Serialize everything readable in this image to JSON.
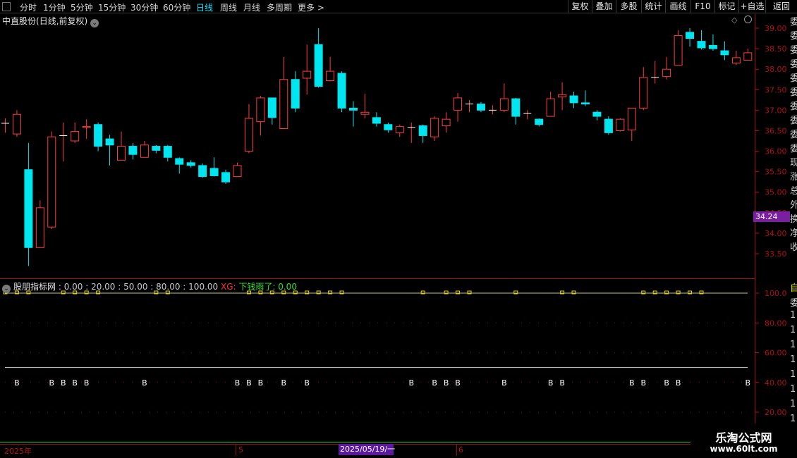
{
  "toolbar": {
    "periods": [
      "分时",
      "1分钟",
      "5分钟",
      "15分钟",
      "30分钟",
      "60分钟",
      "日线",
      "周线",
      "月线",
      "多周期",
      "更多 >"
    ],
    "active_period": "日线",
    "buttons": [
      "复权",
      "叠加",
      "多股",
      "统计",
      "画线",
      "F10",
      "标记",
      "+自选",
      "返回"
    ]
  },
  "stock": {
    "name": "中直股份",
    "mode": "(日线,前复权)"
  },
  "price_axis": {
    "labels": [
      "39.00",
      "38.50",
      "38.00",
      "37.50",
      "37.00",
      "36.50",
      "36.00",
      "35.50",
      "35.00",
      "34.50",
      "34.00",
      "33.50"
    ],
    "current_price": "34.24"
  },
  "indicator": {
    "name": "股朋指标网",
    "params": ": 0.00 : 20.00 : 50.00 : 80.00 : 100.00",
    "xg_label": "XG:",
    "xg_text": "下钱雨了: 0.00",
    "axis_labels": [
      "100.0",
      "80.00",
      "60.00",
      "40.00",
      "20.00"
    ],
    "marker_label": "B"
  },
  "dates": {
    "start": "2025年",
    "m5": "5",
    "m6": "6",
    "cursor": "2025/05/19/一"
  },
  "watermark": {
    "title": "乐淘公式网",
    "url": "www.60lt.com"
  },
  "right_strip": {
    "chars": [
      "委",
      "委",
      "委",
      "委",
      "委",
      "委",
      "委",
      "委",
      "委",
      "委",
      "现",
      "涨",
      "总",
      "外",
      "换",
      "净",
      "收"
    ],
    "chars2": [
      "自",
      "委",
      "1",
      "1",
      "1",
      "1",
      "1",
      "1",
      "1",
      "1",
      "1"
    ]
  },
  "colors": {
    "up": "#ff3c3c",
    "down": "#00e6f0",
    "axis": "#b01010",
    "marker_yellow": "#e6d600",
    "current_price_bg": "#7b1fa2"
  },
  "chart_data": {
    "type": "candlestick",
    "y_axis": {
      "min": 33.5,
      "max": 39.0,
      "ticks": [
        33.5,
        34.0,
        34.5,
        35.0,
        35.5,
        36.0,
        36.5,
        37.0,
        37.5,
        38.0,
        38.5,
        39.0
      ]
    },
    "candles": [
      {
        "o": 36.68,
        "c": 36.68,
        "h": 36.8,
        "l": 36.45
      },
      {
        "o": 36.42,
        "c": 36.9,
        "h": 37.0,
        "l": 36.35
      },
      {
        "o": 35.55,
        "c": 33.65,
        "h": 36.2,
        "l": 33.2
      },
      {
        "o": 33.65,
        "c": 34.62,
        "h": 34.8,
        "l": 33.65
      },
      {
        "o": 34.15,
        "c": 36.35,
        "h": 36.48,
        "l": 34.1
      },
      {
        "o": 36.38,
        "c": 36.38,
        "h": 36.7,
        "l": 35.75
      },
      {
        "o": 36.25,
        "c": 36.48,
        "h": 36.7,
        "l": 36.2
      },
      {
        "o": 36.58,
        "c": 36.6,
        "h": 36.78,
        "l": 36.3
      },
      {
        "o": 36.65,
        "c": 36.12,
        "h": 36.7,
        "l": 36.0
      },
      {
        "o": 36.3,
        "c": 36.15,
        "h": 36.4,
        "l": 35.65
      },
      {
        "o": 35.78,
        "c": 36.12,
        "h": 36.48,
        "l": 35.78
      },
      {
        "o": 36.12,
        "c": 35.92,
        "h": 36.2,
        "l": 35.8
      },
      {
        "o": 35.85,
        "c": 36.15,
        "h": 36.25,
        "l": 35.85
      },
      {
        "o": 36.12,
        "c": 36.02,
        "h": 36.15,
        "l": 35.95
      },
      {
        "o": 36.12,
        "c": 35.85,
        "h": 36.15,
        "l": 35.75
      },
      {
        "o": 35.82,
        "c": 35.68,
        "h": 35.85,
        "l": 35.45
      },
      {
        "o": 35.72,
        "c": 35.65,
        "h": 35.78,
        "l": 35.6
      },
      {
        "o": 35.65,
        "c": 35.38,
        "h": 35.7,
        "l": 35.35
      },
      {
        "o": 35.58,
        "c": 35.4,
        "h": 35.85,
        "l": 35.38
      },
      {
        "o": 35.48,
        "c": 35.25,
        "h": 35.55,
        "l": 35.2
      },
      {
        "o": 35.38,
        "c": 35.65,
        "h": 35.72,
        "l": 35.38
      },
      {
        "o": 36.0,
        "c": 36.8,
        "h": 37.15,
        "l": 35.95
      },
      {
        "o": 36.72,
        "c": 37.3,
        "h": 37.35,
        "l": 36.38
      },
      {
        "o": 37.3,
        "c": 36.82,
        "h": 37.3,
        "l": 36.65
      },
      {
        "o": 36.55,
        "c": 37.75,
        "h": 38.3,
        "l": 36.55
      },
      {
        "o": 37.75,
        "c": 37.05,
        "h": 37.95,
        "l": 36.95
      },
      {
        "o": 37.78,
        "c": 37.95,
        "h": 38.6,
        "l": 37.38
      },
      {
        "o": 38.6,
        "c": 37.58,
        "h": 39.0,
        "l": 37.55
      },
      {
        "o": 37.72,
        "c": 37.95,
        "h": 38.3,
        "l": 37.7
      },
      {
        "o": 37.9,
        "c": 37.05,
        "h": 37.95,
        "l": 36.95
      },
      {
        "o": 37.05,
        "c": 37.0,
        "h": 37.22,
        "l": 36.6
      },
      {
        "o": 36.9,
        "c": 36.95,
        "h": 37.4,
        "l": 36.8
      },
      {
        "o": 36.82,
        "c": 36.68,
        "h": 36.95,
        "l": 36.6
      },
      {
        "o": 36.65,
        "c": 36.52,
        "h": 36.7,
        "l": 36.45
      },
      {
        "o": 36.45,
        "c": 36.6,
        "h": 36.65,
        "l": 36.35
      },
      {
        "o": 36.58,
        "c": 36.58,
        "h": 36.7,
        "l": 36.2
      },
      {
        "o": 36.62,
        "c": 36.38,
        "h": 36.65,
        "l": 36.2
      },
      {
        "o": 36.35,
        "c": 36.8,
        "h": 36.85,
        "l": 36.25
      },
      {
        "o": 36.62,
        "c": 36.78,
        "h": 36.95,
        "l": 36.45
      },
      {
        "o": 37.0,
        "c": 37.3,
        "h": 37.42,
        "l": 36.72
      },
      {
        "o": 37.15,
        "c": 37.15,
        "h": 37.25,
        "l": 36.95
      },
      {
        "o": 37.15,
        "c": 37.0,
        "h": 37.2,
        "l": 36.95
      },
      {
        "o": 37.0,
        "c": 37.0,
        "h": 37.12,
        "l": 36.9
      },
      {
        "o": 37.0,
        "c": 37.28,
        "h": 37.65,
        "l": 36.95
      },
      {
        "o": 37.28,
        "c": 36.85,
        "h": 37.3,
        "l": 36.65
      },
      {
        "o": 36.92,
        "c": 36.92,
        "h": 37.0,
        "l": 36.78
      },
      {
        "o": 36.78,
        "c": 36.65,
        "h": 36.8,
        "l": 36.6
      },
      {
        "o": 36.85,
        "c": 37.28,
        "h": 37.45,
        "l": 36.85
      },
      {
        "o": 37.32,
        "c": 37.38,
        "h": 37.68,
        "l": 37.0
      },
      {
        "o": 37.35,
        "c": 37.18,
        "h": 37.45,
        "l": 37.05
      },
      {
        "o": 37.18,
        "c": 37.15,
        "h": 37.48,
        "l": 37.1
      },
      {
        "o": 36.95,
        "c": 36.85,
        "h": 37.0,
        "l": 36.75
      },
      {
        "o": 36.78,
        "c": 36.45,
        "h": 36.85,
        "l": 36.4
      },
      {
        "o": 36.5,
        "c": 36.78,
        "h": 36.8,
        "l": 36.48
      },
      {
        "o": 36.52,
        "c": 37.05,
        "h": 37.05,
        "l": 36.25
      },
      {
        "o": 37.05,
        "c": 37.8,
        "h": 38.05,
        "l": 37.0
      },
      {
        "o": 37.8,
        "c": 37.8,
        "h": 38.2,
        "l": 37.65
      },
      {
        "o": 37.82,
        "c": 38.0,
        "h": 38.3,
        "l": 37.75
      },
      {
        "o": 38.1,
        "c": 38.82,
        "h": 38.95,
        "l": 38.1
      },
      {
        "o": 38.9,
        "c": 38.75,
        "h": 39.0,
        "l": 38.55
      },
      {
        "o": 38.68,
        "c": 38.52,
        "h": 38.95,
        "l": 38.48
      },
      {
        "o": 38.58,
        "c": 38.5,
        "h": 38.85,
        "l": 38.45
      },
      {
        "o": 38.45,
        "c": 38.35,
        "h": 38.68,
        "l": 38.22
      },
      {
        "o": 38.15,
        "c": 38.28,
        "h": 38.45,
        "l": 38.1
      },
      {
        "o": 38.22,
        "c": 38.4,
        "h": 38.5,
        "l": 38.22
      }
    ],
    "indicator": {
      "y_axis": {
        "min": 10,
        "max": 100,
        "ticks": [
          100,
          80,
          60,
          40,
          20
        ]
      },
      "lines": [
        {
          "name": "100.00",
          "value": 100
        },
        {
          "name": "50.00",
          "value": 50
        }
      ],
      "b_marker_value": 40,
      "b_marker_indices": [
        1,
        4,
        5,
        6,
        7,
        12,
        20,
        21,
        22,
        24,
        26,
        35,
        37,
        38,
        39,
        43,
        47,
        48,
        54,
        55,
        57,
        58,
        64
      ],
      "yellow_dot_indices": [
        0,
        1,
        2,
        5,
        6,
        7,
        8,
        13,
        14,
        21,
        22,
        23,
        24,
        25,
        26,
        27,
        28,
        29,
        36,
        38,
        39,
        40,
        44,
        48,
        49,
        55,
        56,
        57,
        58,
        59,
        60
      ]
    }
  }
}
